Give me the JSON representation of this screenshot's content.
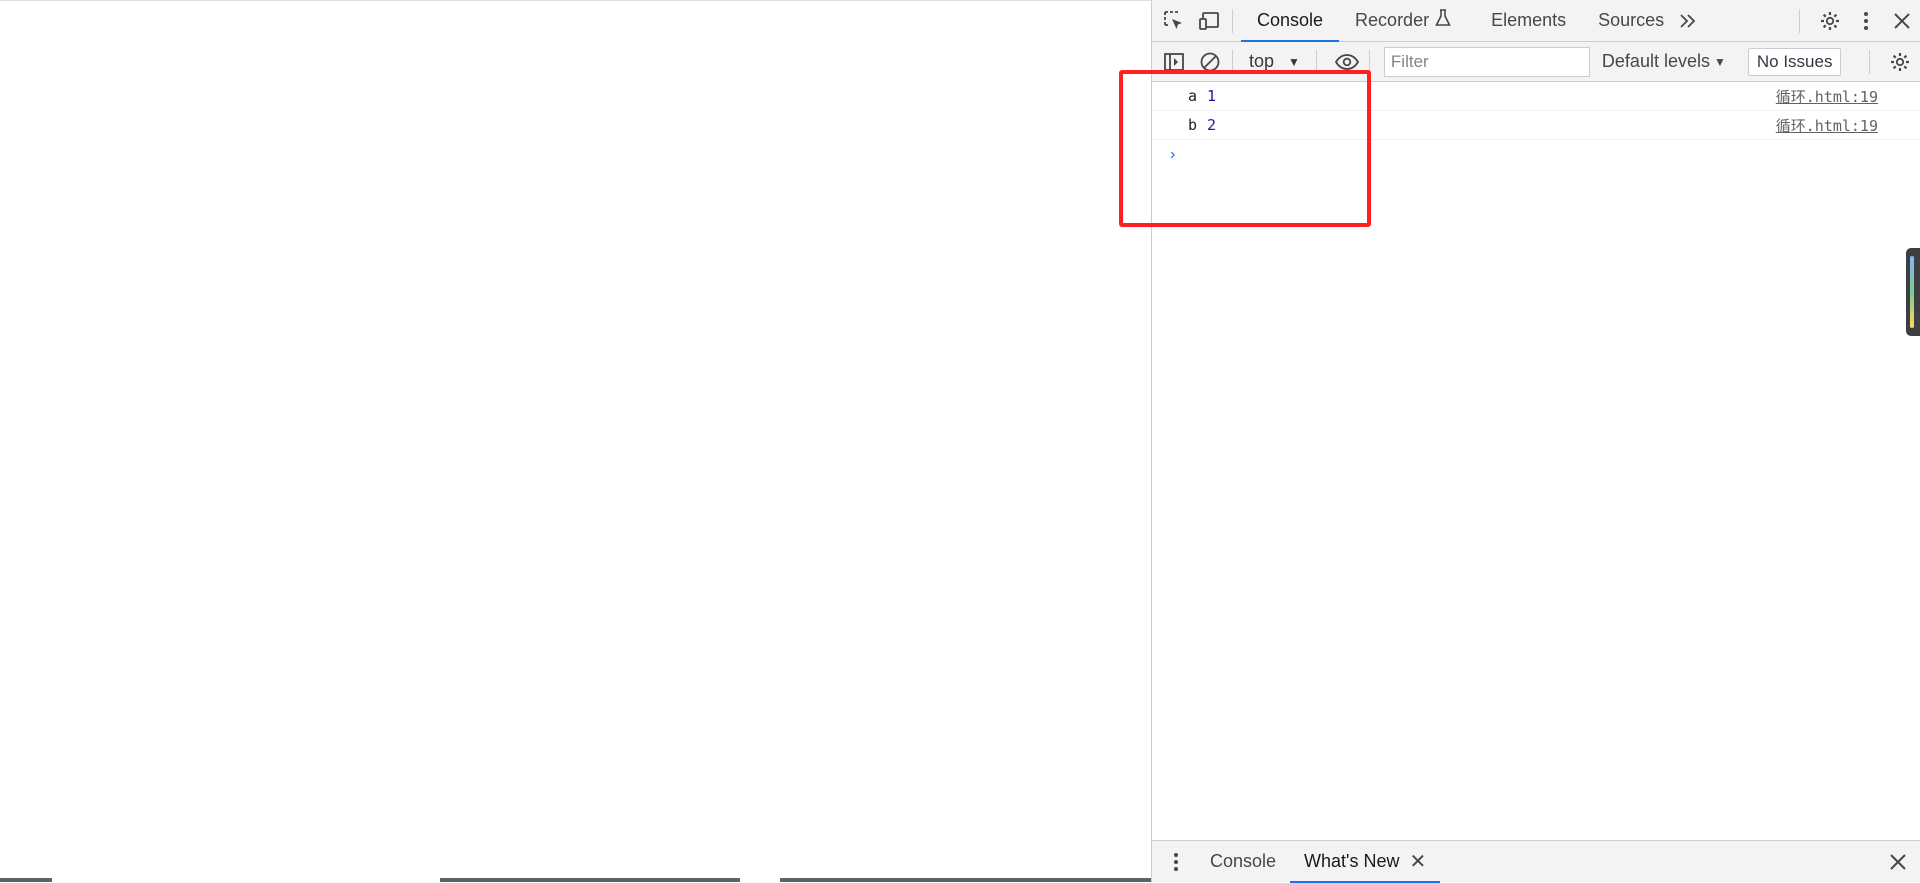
{
  "devtools": {
    "tabs": [
      {
        "label": "Console",
        "active": true
      },
      {
        "label": "Recorder",
        "active": false
      },
      {
        "label": "Elements",
        "active": false
      },
      {
        "label": "Sources",
        "active": false
      }
    ],
    "toolbar": {
      "context": "top",
      "filter_placeholder": "Filter",
      "levels": "Default levels",
      "issues": "No Issues"
    },
    "console": {
      "rows": [
        {
          "key": "a",
          "value": "1",
          "source": "循环.html:19"
        },
        {
          "key": "b",
          "value": "2",
          "source": "循环.html:19"
        }
      ],
      "prompt": "›"
    },
    "drawer": {
      "tabs": [
        {
          "label": "Console",
          "active": false
        },
        {
          "label": "What's New",
          "active": true
        }
      ]
    }
  },
  "colors": {
    "accent": "#1a73e8",
    "highlight": "#ff2020",
    "number": "#1a1aa6"
  }
}
